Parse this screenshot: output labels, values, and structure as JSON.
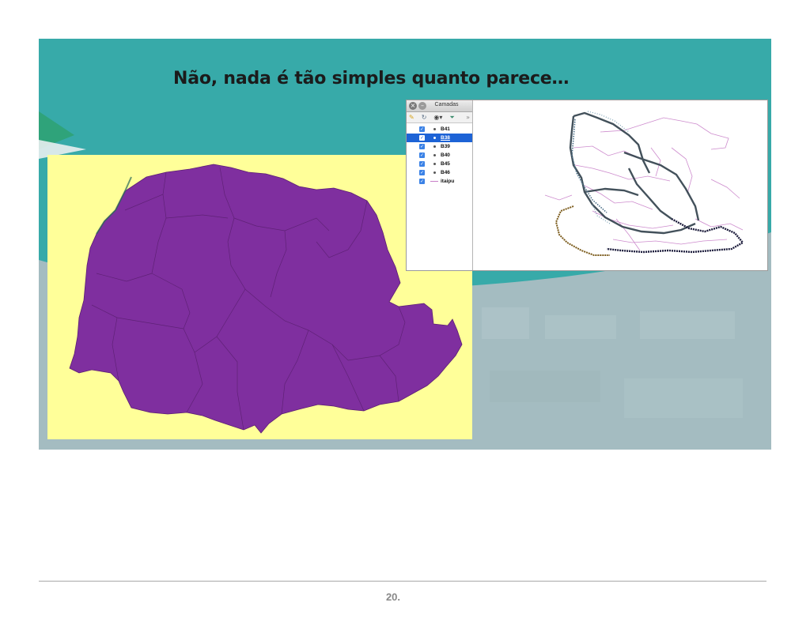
{
  "slide": {
    "title": "Não, nada é tão simples quanto parece…",
    "page_number": "20.",
    "colors": {
      "teal": "#37aaa9",
      "teal_dark": "#2e9e9f",
      "green_stripe": "#2fa37a",
      "bottom_gray": "#a4bcc1",
      "map_background": "#ffff99",
      "map_fill": "#7f2f9f",
      "layer_selected": "#1d63d6"
    }
  },
  "layers_panel": {
    "title": "Camadas",
    "close_icon": "close-icon",
    "minimize_icon": "minimize-icon",
    "toolbar": {
      "style_icon": "paint-brush-icon",
      "refresh_icon": "refresh-icon",
      "visibility_icon": "eye-icon",
      "filter_icon": "filter-icon",
      "more_icon": "chevron-double-right-icon",
      "brush_glyph": "✎",
      "refresh_glyph": "↻",
      "eye_glyph": "◉▾",
      "filter_glyph": "⏷",
      "more_glyph": "»"
    },
    "check_glyph": "✓",
    "layers": [
      {
        "label": "B41",
        "checked": true,
        "selected": false,
        "symbol": "point"
      },
      {
        "label": "B38",
        "checked": true,
        "selected": true,
        "symbol": "point"
      },
      {
        "label": "B39",
        "checked": true,
        "selected": false,
        "symbol": "point"
      },
      {
        "label": "B40",
        "checked": true,
        "selected": false,
        "symbol": "point"
      },
      {
        "label": "B45",
        "checked": true,
        "selected": false,
        "symbol": "point"
      },
      {
        "label": "B46",
        "checked": true,
        "selected": false,
        "symbol": "point"
      },
      {
        "label": "itaipu",
        "checked": true,
        "selected": false,
        "symbol": "line"
      }
    ]
  }
}
